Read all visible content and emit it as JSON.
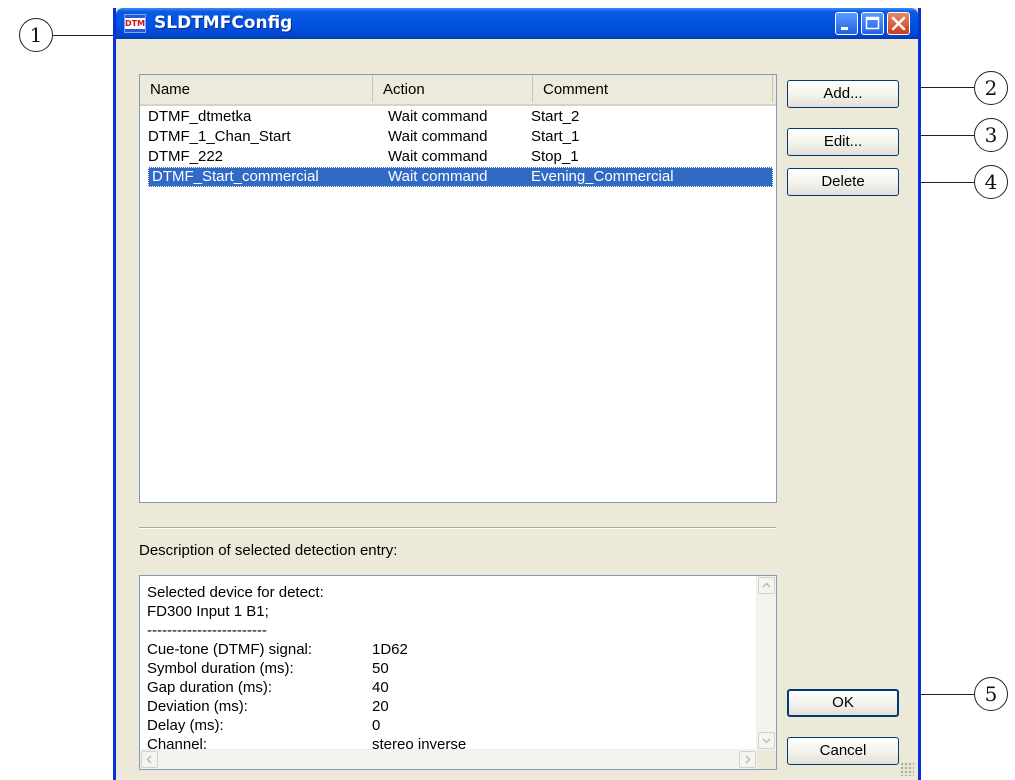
{
  "callouts": {
    "c1": "1",
    "c2": "2",
    "c3": "3",
    "c4": "4",
    "c5": "5"
  },
  "window": {
    "title": "SLDTMFConfig",
    "icon_text": "DTMF"
  },
  "list": {
    "columns": [
      "Name",
      "Action",
      "Comment"
    ],
    "rows": [
      {
        "name": "DTMF_dtmetka",
        "action": "Wait command",
        "comment": "Start_2"
      },
      {
        "name": "DTMF_1_Chan_Start",
        "action": "Wait command",
        "comment": "Start_1"
      },
      {
        "name": "DTMF_222",
        "action": "Wait command",
        "comment": "Stop_1"
      },
      {
        "name": "DTMF_Start_commercial",
        "action": "Wait command",
        "comment": "Evening_Commercial"
      }
    ],
    "selected_index": 3
  },
  "description": {
    "label": "Description of selected detection entry:",
    "lines": [
      {
        "key": "Selected device for detect:",
        "value": ""
      },
      {
        "key": "FD300 Input 1 B1;",
        "value": ""
      },
      {
        "key": "------------------------",
        "value": ""
      },
      {
        "key": "Cue-tone (DTMF) signal:",
        "value": "1D62"
      },
      {
        "key": "Symbol duration (ms):",
        "value": "50"
      },
      {
        "key": "Gap duration (ms):",
        "value": "40"
      },
      {
        "key": "Deviation (ms):",
        "value": "20"
      },
      {
        "key": "Delay (ms):",
        "value": "0"
      },
      {
        "key": "Channel:",
        "value": "stereo inverse"
      }
    ]
  },
  "buttons": {
    "add": "Add...",
    "edit": "Edit...",
    "delete": "Delete",
    "ok": "OK",
    "cancel": "Cancel"
  },
  "colors": {
    "titlebar": "#0054e3",
    "dialog_bg": "#ece9d8",
    "selection": "#316ac5",
    "close_button": "#cc3b1c"
  }
}
